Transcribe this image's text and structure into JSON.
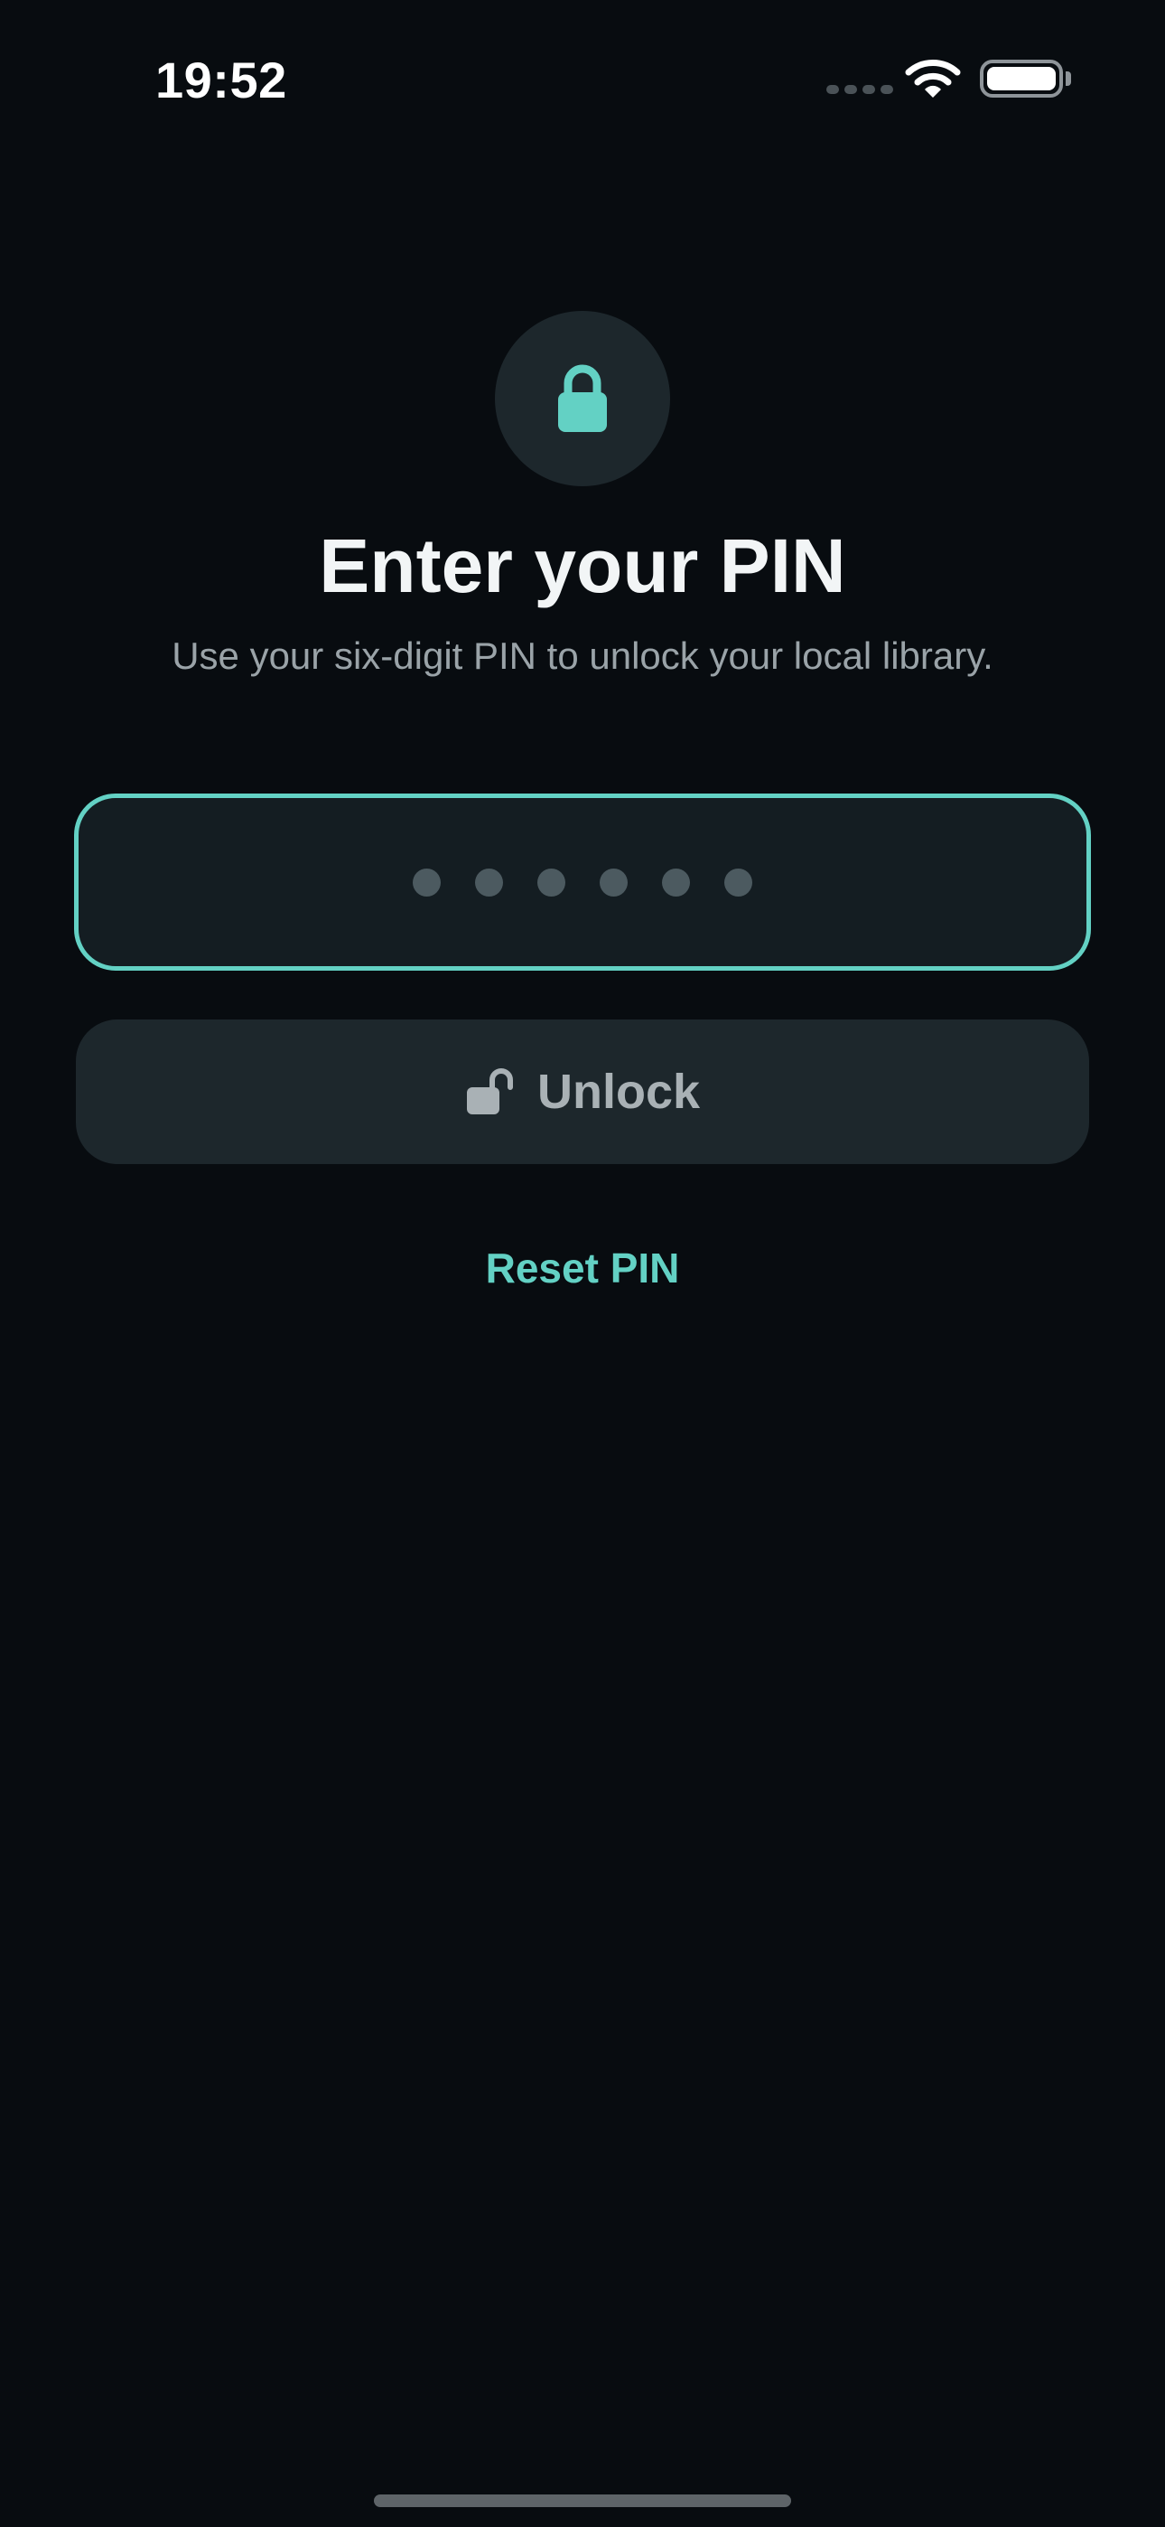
{
  "status_bar": {
    "time": "19:52"
  },
  "header": {
    "icon": "lock-icon",
    "title": "Enter your PIN",
    "subtitle": "Use your six-digit PIN to unlock your local library."
  },
  "pin_field": {
    "length": 6,
    "entered": 0
  },
  "unlock_button": {
    "icon": "lock-open-icon",
    "label": "Unlock"
  },
  "reset_link": {
    "label": "Reset PIN"
  },
  "colors": {
    "background": "#080c10",
    "accent": "#63d1c4",
    "surface": "#1d272c",
    "field_bg": "#141d22",
    "dot": "#4c5a60",
    "muted_text": "#9aa3a8"
  }
}
